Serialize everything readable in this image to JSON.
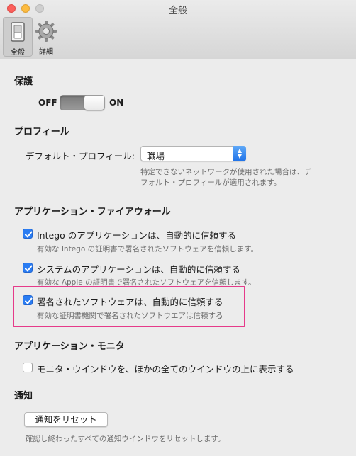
{
  "window": {
    "title": "全般"
  },
  "toolbar": {
    "general_label": "全般",
    "general_icon": "switch-icon",
    "detail_label": "詳細",
    "detail_icon": "gear-icon"
  },
  "protection": {
    "title": "保護",
    "off_label": "OFF",
    "on_label": "ON",
    "state": "on"
  },
  "profile": {
    "title": "プロフィール",
    "default_label": "デフォルト・プロフィール:",
    "selected": "職場",
    "help_line1": "特定できないネットワークが使用された場合は、デ",
    "help_line2": "フォルト・プロフィールが適用されます。"
  },
  "firewall": {
    "title": "アプリケーション・ファイアウォール",
    "items": [
      {
        "label": "Intego のアプリケーションは、自動的に信頼する",
        "sub": "有効な Intego の証明書で署名されたソフトウェアを信頼します。",
        "checked": true
      },
      {
        "label": "システムのアプリケーションは、自動的に信頼する",
        "sub": "有効な Apple の証明書で署名されたソフトウェアを信頼します。",
        "checked": true
      },
      {
        "label": "署名されたソフトウェアは、自動的に信頼する",
        "sub": "有効な証明書機関で署名されたソフトウエアは信頼する",
        "checked": true
      }
    ],
    "highlight_color": "#e63a8a"
  },
  "monitor": {
    "title": "アプリケーション・モニタ",
    "item": {
      "label": "モニタ・ウインドウを、ほかの全てのウインドウの上に表示する",
      "checked": false
    }
  },
  "notifications": {
    "title": "通知",
    "reset_button": "通知をリセット",
    "help": "確認し終わったすべての通知ウインドウをリセットします。"
  },
  "colors": {
    "accent": "#2a7cf2"
  }
}
